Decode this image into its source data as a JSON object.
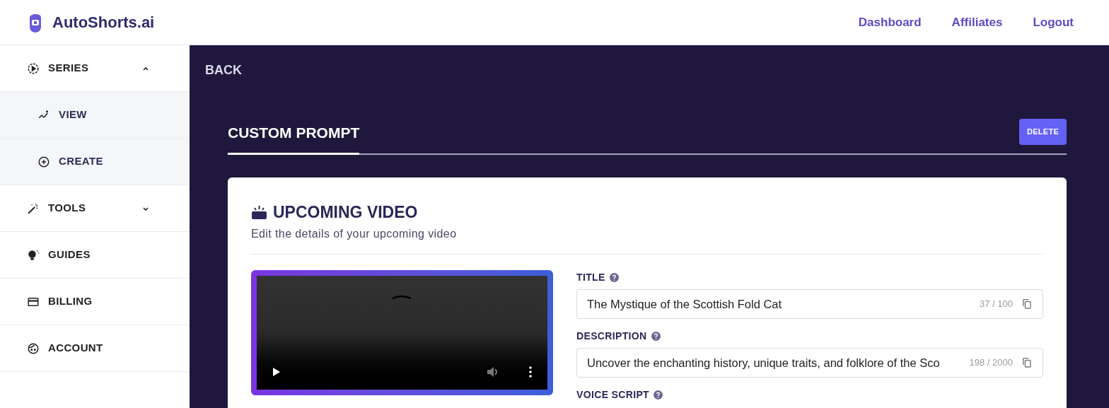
{
  "header": {
    "brand": "AutoShorts.ai",
    "links": [
      "Dashboard",
      "Affiliates",
      "Logout"
    ]
  },
  "sidebar": {
    "items": [
      {
        "label": "SERIES",
        "kind": "series",
        "expanded": true,
        "children": [
          {
            "label": "VIEW",
            "kind": "view"
          },
          {
            "label": "CREATE",
            "kind": "create"
          }
        ]
      },
      {
        "label": "TOOLS",
        "kind": "tools",
        "expanded": false
      },
      {
        "label": "GUIDES",
        "kind": "guides"
      },
      {
        "label": "BILLING",
        "kind": "billing"
      },
      {
        "label": "ACCOUNT",
        "kind": "account"
      }
    ]
  },
  "main": {
    "back": "BACK",
    "tabs": [
      {
        "label": "CUSTOM PROMPT",
        "selected": true
      }
    ],
    "delete_button": "DELETE",
    "card": {
      "title": "UPCOMING VIDEO",
      "subtitle": "Edit the details of your upcoming video",
      "fields": [
        {
          "label": "TITLE",
          "value": "The Mystique of the Scottish Fold Cat",
          "counter": "37 / 100"
        },
        {
          "label": "DESCRIPTION",
          "value": "Uncover the enchanting history, unique traits, and folklore of the Sco",
          "counter": "198 / 2000"
        },
        {
          "label": "VOICE SCRIPT"
        }
      ]
    }
  }
}
